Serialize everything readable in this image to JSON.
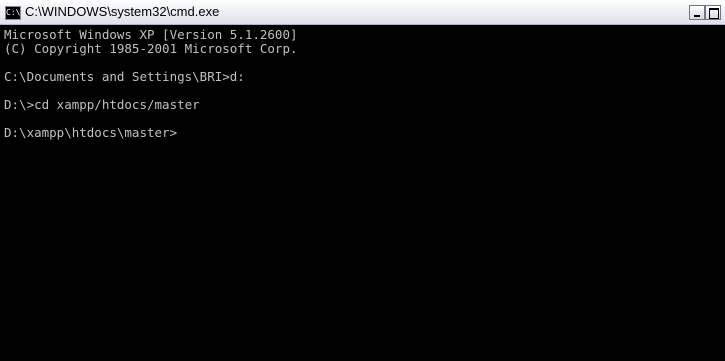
{
  "window": {
    "title": "C:\\WINDOWS\\system32\\cmd.exe",
    "icon": "cmd-icon",
    "icon_glyph": "C:\\"
  },
  "console": {
    "lines": [
      "Microsoft Windows XP [Version 5.1.2600]",
      "(C) Copyright 1985-2001 Microsoft Corp.",
      "",
      "C:\\Documents and Settings\\BRI>d:",
      "",
      "D:\\>cd xampp/htdocs/master",
      "",
      "D:\\xampp\\htdocs\\master>"
    ],
    "text_color": "#c0c0c0",
    "background_color": "#000000"
  }
}
